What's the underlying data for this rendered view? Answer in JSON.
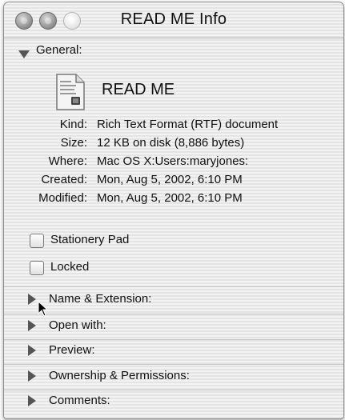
{
  "window": {
    "title": "READ ME Info"
  },
  "general": {
    "label": "General:",
    "file_name": "READ ME",
    "rows": [
      {
        "label": "Kind:",
        "value": "Rich Text Format (RTF) document"
      },
      {
        "label": "Size:",
        "value": "12 KB on disk (8,886 bytes)"
      },
      {
        "label": "Where:",
        "value": "Mac OS X:Users:maryjones:"
      },
      {
        "label": "Created:",
        "value": "Mon, Aug 5, 2002, 6:10 PM"
      },
      {
        "label": "Modified:",
        "value": "Mon, Aug 5, 2002, 6:10 PM"
      }
    ],
    "checkboxes": [
      {
        "label": "Stationery Pad",
        "checked": false
      },
      {
        "label": "Locked",
        "checked": false
      }
    ]
  },
  "sections": [
    {
      "label": "Name & Extension:"
    },
    {
      "label": "Open with:"
    },
    {
      "label": "Preview:"
    },
    {
      "label": "Ownership & Permissions:"
    },
    {
      "label": "Comments:"
    }
  ],
  "icons": {
    "close": "close-button-icon",
    "minimize": "minimize-button-icon",
    "zoom": "zoom-button-icon",
    "file": "rtf-document-icon",
    "cursor": "mouse-pointer-icon"
  }
}
